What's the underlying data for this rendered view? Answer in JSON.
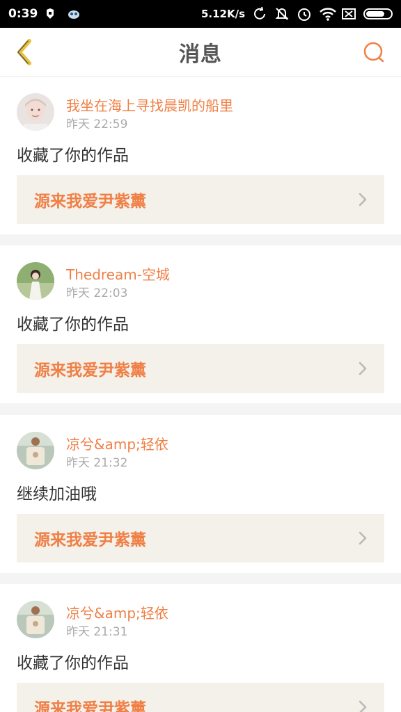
{
  "status_bar": {
    "time": "0:39",
    "net_speed": "5.12K/s",
    "battery_level": 0.75,
    "icons": [
      "app-icon-1",
      "app-icon-2",
      "sync-icon",
      "mute-icon",
      "alarm-icon",
      "wifi-icon",
      "sim-icon",
      "battery-icon"
    ]
  },
  "header": {
    "title": "消息",
    "back_icon": "chevron-left-icon",
    "search_icon": "search-icon"
  },
  "messages": [
    {
      "user": "我坐在海上寻找晨凯的船里",
      "time": "昨天 22:59",
      "action": "收藏了你的作品",
      "work": "源来我爱尹紫薰"
    },
    {
      "user": "Thedream-空城",
      "time": "昨天 22:03",
      "action": "收藏了你的作品",
      "work": "源来我爱尹紫薰"
    },
    {
      "user": "凉兮&amp;轻依",
      "time": "昨天 21:32",
      "action": "继续加油哦",
      "work": "源来我爱尹紫薰"
    },
    {
      "user": "凉兮&amp;轻依",
      "time": "昨天 21:31",
      "action": "收藏了你的作品",
      "work": "源来我爱尹紫薰"
    }
  ],
  "colors": {
    "accent": "#f07f45",
    "back_icon": "#e8c23a",
    "work_bg": "#f3f1ea",
    "separator": "#f4f4f4"
  }
}
